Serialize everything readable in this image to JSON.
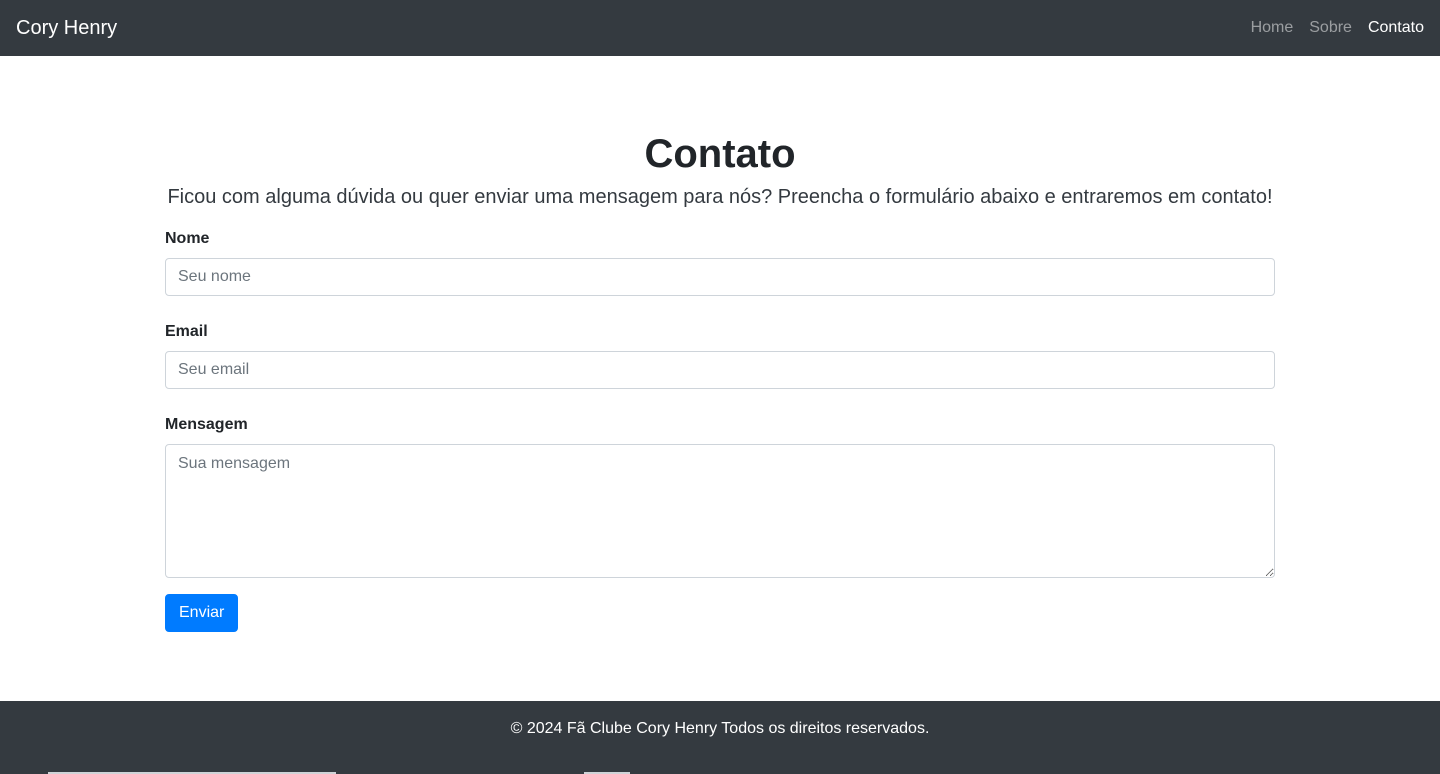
{
  "navbar": {
    "brand": "Cory Henry",
    "links": [
      {
        "label": "Home",
        "active": false
      },
      {
        "label": "Sobre",
        "active": false
      },
      {
        "label": "Contato",
        "active": true
      }
    ]
  },
  "main": {
    "title": "Contato",
    "lead": "Ficou com alguma dúvida ou quer enviar uma mensagem para nós? Preencha o formulário abaixo e entraremos em contato!",
    "form": {
      "name": {
        "label": "Nome",
        "placeholder": "Seu nome",
        "value": ""
      },
      "email": {
        "label": "Email",
        "placeholder": "Seu email",
        "value": ""
      },
      "message": {
        "label": "Mensagem",
        "placeholder": "Sua mensagem",
        "value": ""
      },
      "submit_label": "Enviar"
    }
  },
  "footer": {
    "text": "© 2024 Fã Clube Cory Henry Todos os direitos reservados."
  },
  "colors": {
    "navbar_bg": "#343a40",
    "primary": "#007bff",
    "text": "#212529"
  }
}
